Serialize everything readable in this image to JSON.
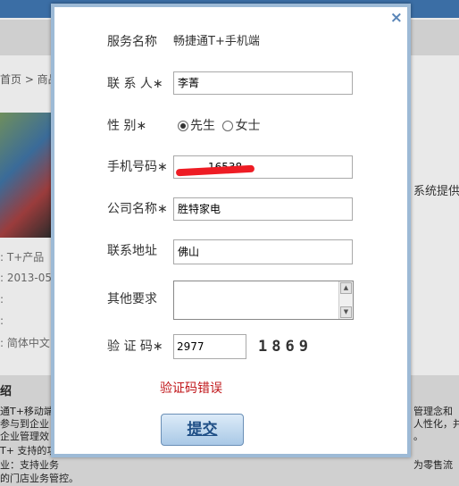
{
  "background": {
    "breadcrumb": "首页 > 商品详",
    "product_type": "T+产品",
    "date": "2013-05-",
    "language": "简体中文",
    "side_text": "系统提供",
    "section_heading": "绍",
    "desc_lines": [
      "通T+移动端",
      "参与到企业",
      "企业管理效",
      "T+ 支持的功",
      "业：支持业务",
      "的门店业务管控。"
    ],
    "right_lines": [
      "管理念和",
      "人性化，并",
      "。",
      "为零售流"
    ]
  },
  "modal": {
    "close_icon": "×",
    "service_label": "服务名称",
    "service_value": "畅捷通T+手机端",
    "contact_label": "联 系 人",
    "contact_value": "李菁",
    "gender_label": "性    别",
    "gender_options": [
      "先生",
      "女士"
    ],
    "gender_selected": "先生",
    "phone_label": "手机号码",
    "phone_value": "16538",
    "company_label": "公司名称",
    "company_value": "胜特家电",
    "address_label": "联系地址",
    "address_value": "佛山",
    "other_label": "其他要求",
    "other_value": "",
    "captcha_label": "验 证 码",
    "captcha_value": "2977",
    "captcha_image_text": "1869",
    "required_mark": "∗",
    "error_text": "验证码错误",
    "submit_label": "提交"
  },
  "colors": {
    "modal_border": "#9dbad6",
    "error": "#c0161a",
    "submit_text": "#1f4f86",
    "redaction": "#ee1c24"
  }
}
